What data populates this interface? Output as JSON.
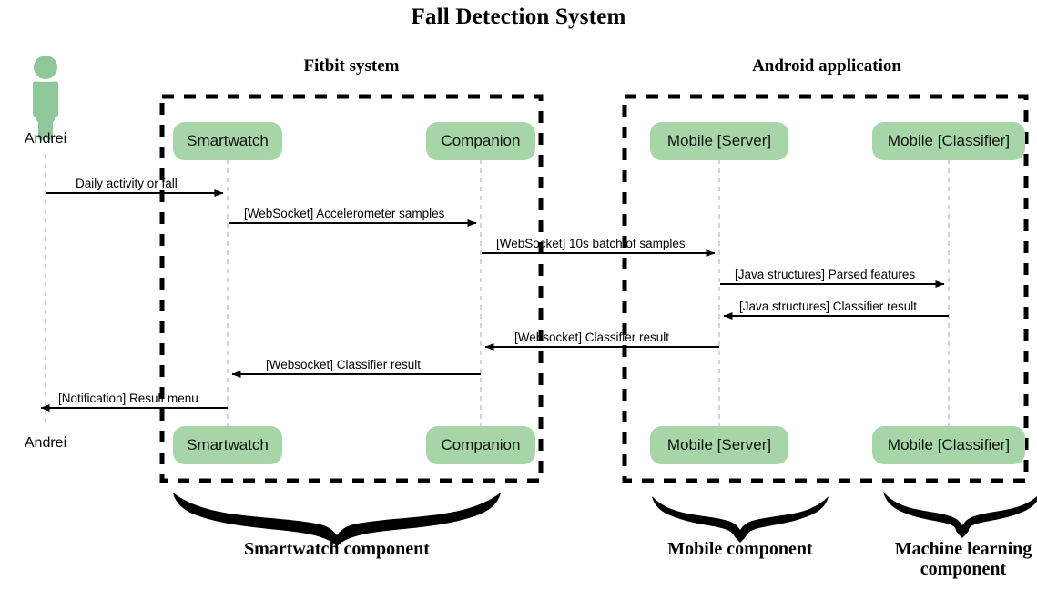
{
  "title": "Fall Detection System",
  "groups": [
    {
      "id": "fitbit",
      "label": "Fitbit system"
    },
    {
      "id": "android",
      "label": "Android application"
    }
  ],
  "actor": {
    "icon": "person-icon",
    "name_top": "Andrei",
    "name_bottom": "Andrei",
    "color": "#8fc79a"
  },
  "participants": [
    {
      "id": "smartwatch",
      "label": "Smartwatch",
      "label_bottom": "Smartwatch"
    },
    {
      "id": "companion",
      "label": "Companion",
      "label_bottom": "Companion"
    },
    {
      "id": "mobile_server",
      "label": "Mobile [Server]",
      "label_bottom": "Mobile [Server]"
    },
    {
      "id": "mobile_classifier",
      "label": "Mobile [Classifier]",
      "label_bottom": "Mobile [Classifier]"
    }
  ],
  "messages": [
    {
      "id": "m1",
      "label": "Daily activity or fall",
      "from": "andrei",
      "to": "smartwatch",
      "direction": "right"
    },
    {
      "id": "m2",
      "label": "[WebSocket] Accelerometer samples",
      "from": "smartwatch",
      "to": "companion",
      "direction": "right"
    },
    {
      "id": "m3",
      "label": "[WebSocket] 10s batch of samples",
      "from": "companion",
      "to": "mobile_server",
      "direction": "right"
    },
    {
      "id": "m4",
      "label": "[Java structures] Parsed features",
      "from": "mobile_server",
      "to": "mobile_classifier",
      "direction": "right"
    },
    {
      "id": "m5",
      "label": "[Java structures] Classifier result",
      "from": "mobile_classifier",
      "to": "mobile_server",
      "direction": "left"
    },
    {
      "id": "m6",
      "label": "[Websocket] Classifier result",
      "from": "mobile_server",
      "to": "companion",
      "direction": "left"
    },
    {
      "id": "m7",
      "label": "[Websocket] Classifier result",
      "from": "companion",
      "to": "smartwatch",
      "direction": "left"
    },
    {
      "id": "m8",
      "label": "[Notification] Result menu",
      "from": "smartwatch",
      "to": "andrei",
      "direction": "left"
    }
  ],
  "components": [
    {
      "id": "smartwatch_component",
      "label": "Smartwatch component"
    },
    {
      "id": "mobile_component",
      "label": "Mobile component"
    },
    {
      "id": "ml_component",
      "label": "Machine learning\ncomponent",
      "line1": "Machine learning",
      "line2": "component"
    }
  ],
  "colors": {
    "box_fill": "#a6d5a7",
    "actor": "#8fc79a",
    "line": "#000000",
    "lifeline": "#bcbcbc",
    "background": "#ffffff"
  }
}
